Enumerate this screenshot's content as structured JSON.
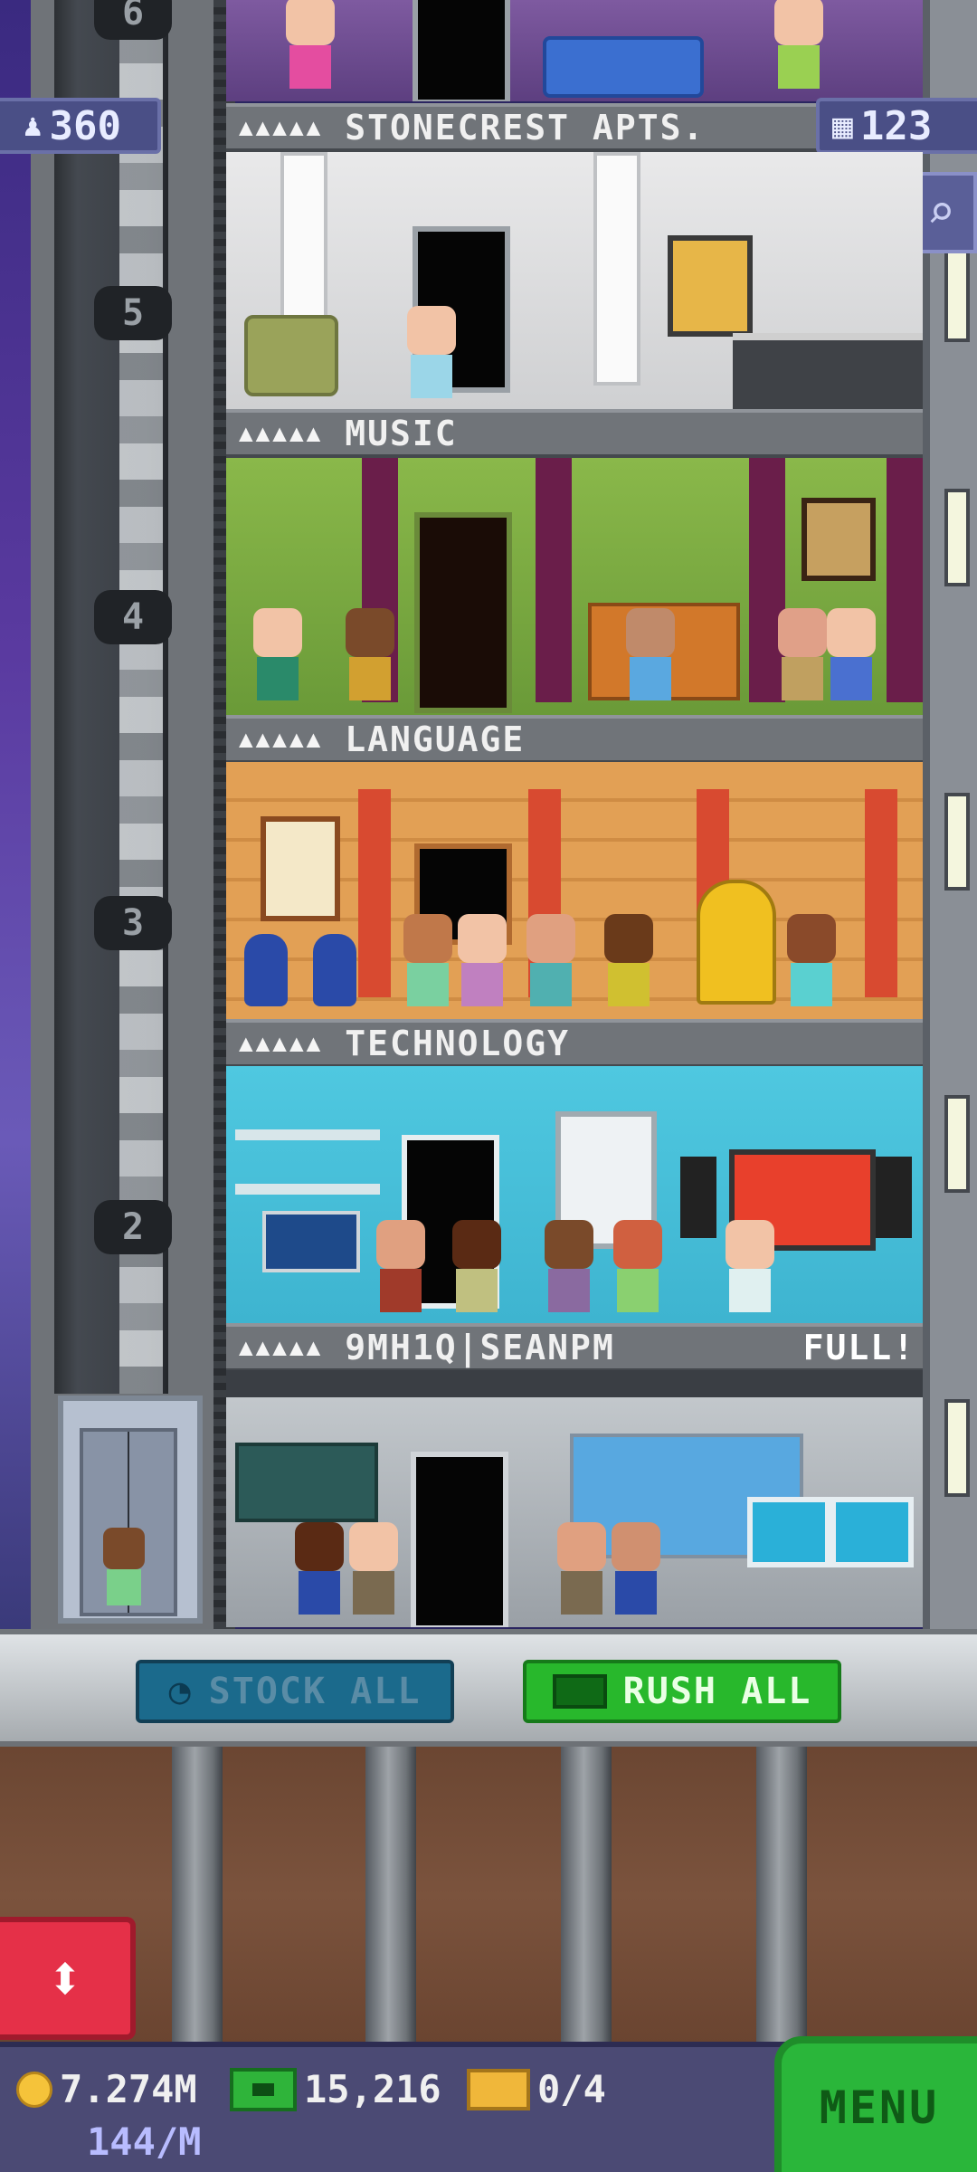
{
  "tower": {
    "population": "360",
    "floor_count": "123"
  },
  "elevator": {
    "floor_numbers": [
      "6",
      "5",
      "4",
      "3",
      "2"
    ]
  },
  "floors": {
    "apartments": {
      "name": "STONECREST APTS.",
      "stars": "▲▲▲▲▲"
    },
    "music": {
      "name": "MUSIC",
      "stars": "▲▲▲▲▲"
    },
    "language": {
      "name": "LANGUAGE",
      "stars": "▲▲▲▲▲"
    },
    "technology": {
      "name": "TECHNOLOGY",
      "stars": "▲▲▲▲▲"
    },
    "residential": {
      "name": "9MH1Q|SEANPM",
      "stars": "▲▲▲▲▲",
      "status": "FULL!"
    }
  },
  "actions": {
    "stock_all": "STOCK ALL",
    "rush_all": "RUSH ALL"
  },
  "hud": {
    "coins": "7.274M",
    "coin_rate": "144/M",
    "bux": "15,216",
    "tickets": "0/4",
    "menu": "MENU"
  },
  "colors": {
    "rush_green": "#28b82c",
    "stock_blue": "#1b6a8c",
    "elevator_red": "#e53048"
  }
}
